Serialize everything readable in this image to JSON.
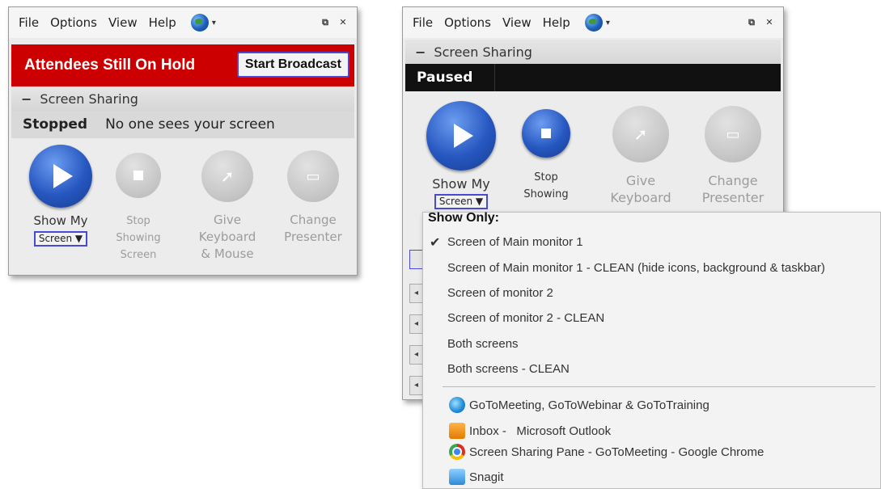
{
  "left_window": {
    "menu": [
      "File",
      "Options",
      "View",
      "Help"
    ],
    "alert_text": "Attendees Still On Hold",
    "broadcast_button": "Start Broadcast",
    "section_title": "Screen Sharing",
    "status_main": "Stopped",
    "status_detail": "No one sees your screen",
    "controls": {
      "show_my": "Show My",
      "screen_select": "Screen ▼",
      "stop_line1": "Stop",
      "stop_line2": "Showing",
      "stop_line3": "Screen",
      "give_line1": "Give",
      "give_line2": "Keyboard",
      "give_line3": "& Mouse",
      "change_line1": "Change",
      "change_line2": "Presenter"
    }
  },
  "right_window": {
    "menu": [
      "File",
      "Options",
      "View",
      "Help"
    ],
    "section_title": "Screen Sharing",
    "status_main": "Paused",
    "controls": {
      "show_my": "Show My",
      "screen_select": "Screen ▼",
      "stop_line1": "Stop",
      "stop_line2": "Showing",
      "give_line1": "Give",
      "give_line2": "Keyboard",
      "change_line1": "Change",
      "change_line2": "Presenter"
    }
  },
  "dropdown": {
    "title": "Show Only:",
    "check_glyph": "✔",
    "selected_index": 0,
    "screen_options": [
      "Screen of Main monitor 1",
      "Screen of Main monitor 1 - CLEAN (hide icons, background & taskbar)",
      "Screen of monitor 2",
      "Screen of monitor 2 - CLEAN",
      "Both screens",
      "Both screens - CLEAN"
    ],
    "apps": [
      {
        "label": "GoToMeeting, GoToWebinar & GoToTraining",
        "icon": "gotomeeting-icon"
      },
      {
        "label": "Inbox -   Microsoft Outlook",
        "icon": "outlook-icon"
      },
      {
        "label": "Screen Sharing Pane - GoToMeeting - Google Chrome",
        "icon": "chrome-icon"
      },
      {
        "label": "Snagit",
        "icon": "snagit-icon"
      }
    ]
  },
  "colors": {
    "alert_red": "#cc0000",
    "active_blue": "#2657c0",
    "paused_black": "#111111"
  }
}
